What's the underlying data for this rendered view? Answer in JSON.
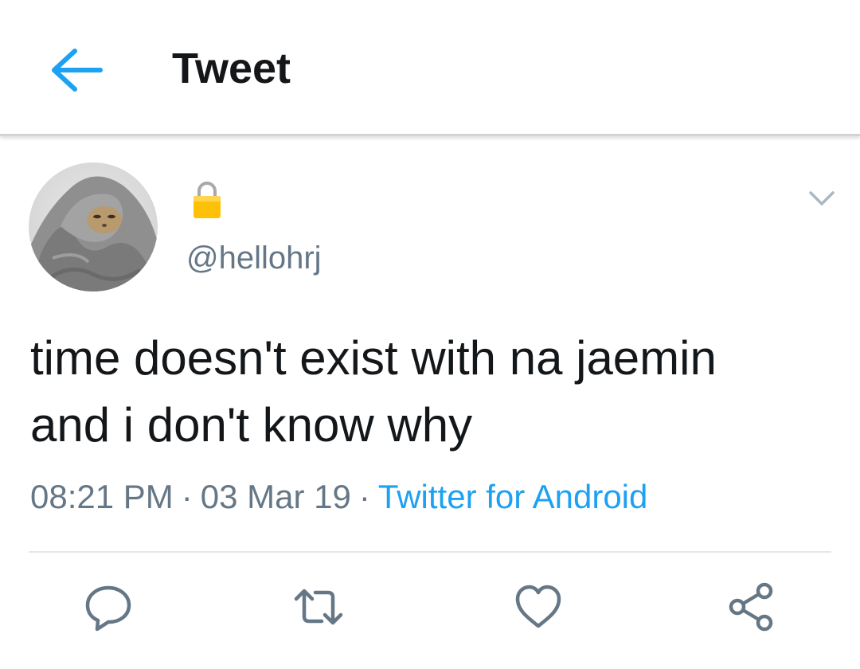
{
  "header": {
    "title": "Tweet",
    "back_icon": "arrow-left-icon"
  },
  "author": {
    "handle": "@hellohrj",
    "protected_icon": "lock-icon",
    "avatar": "grey blanket cat avatar"
  },
  "tweet": {
    "text_line1": "time doesn't exist with na jaemin",
    "text_line2": "and i don't know why",
    "time": "08:21 PM",
    "date": "03 Mar 19",
    "separator": "·",
    "source": "Twitter for Android"
  },
  "actions": {
    "reply_icon": "reply-icon",
    "retweet_icon": "retweet-icon",
    "like_icon": "heart-icon",
    "share_icon": "share-icon"
  },
  "colors": {
    "accent": "#1da1f2",
    "secondary_text": "#657786",
    "primary_text": "#14171a",
    "icon_gray": "#657786"
  }
}
